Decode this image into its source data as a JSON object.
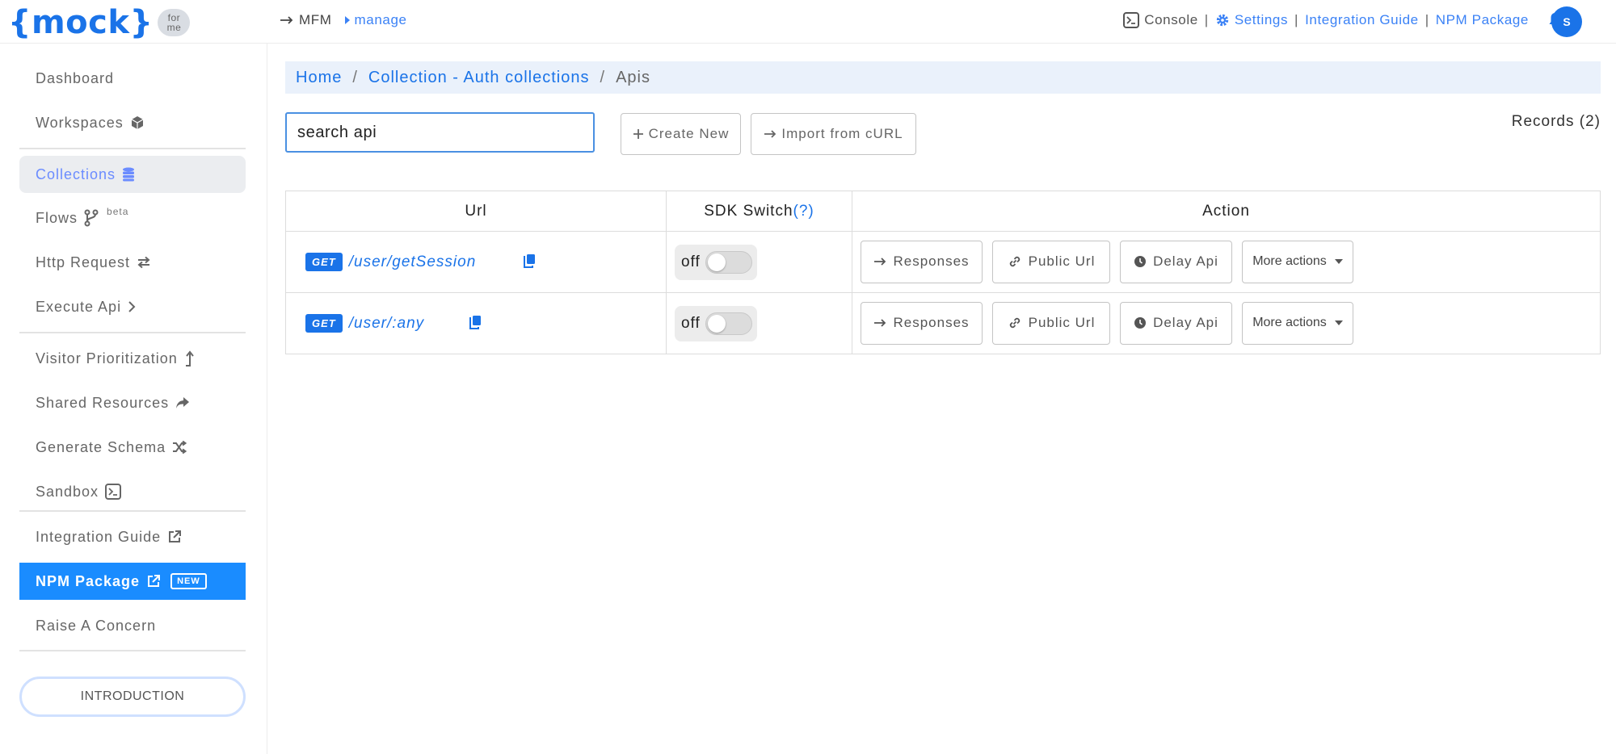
{
  "header": {
    "logo_text": "{mock}",
    "logo_badge_line1": "for",
    "logo_badge_line2": "me",
    "nav_mfm": "MFM",
    "nav_manage": "manage",
    "console": "Console",
    "separator": "|",
    "settings": "Settings",
    "integration_guide": "Integration Guide",
    "npm_package": "NPM Package",
    "avatar_initial": "S",
    "icons": {
      "mfm": "arrow-right-icon",
      "manage": "caret-right-icon",
      "console": "terminal-icon",
      "settings": "gear-icon",
      "notifications": "bell-icon"
    }
  },
  "sidebar": {
    "items": [
      {
        "label": "Dashboard",
        "icon": ""
      },
      {
        "label": "Workspaces",
        "icon": "cube-icon"
      },
      {
        "label": "Collections",
        "icon": "database-icon",
        "active": true
      },
      {
        "label": "Flows",
        "icon": "branch-icon",
        "badge": "beta"
      },
      {
        "label": "Http Request",
        "icon": "exchange-icon"
      },
      {
        "label": "Execute Api",
        "icon": "chevron-right-icon"
      },
      {
        "label": "Visitor Prioritization",
        "icon": "level-up-icon"
      },
      {
        "label": "Shared Resources",
        "icon": "share-icon"
      },
      {
        "label": "Generate Schema",
        "icon": "shuffle-icon"
      },
      {
        "label": "Sandbox",
        "icon": "terminal-icon"
      },
      {
        "label": "Integration Guide",
        "icon": "external-link-icon"
      },
      {
        "label": "NPM Package",
        "icon": "external-link-icon",
        "badge": "NEW",
        "highlight": true
      },
      {
        "label": "Raise A Concern",
        "icon": ""
      }
    ],
    "intro_button": "INTRODUCTION"
  },
  "breadcrumb": {
    "home": "Home",
    "collection": "Collection - Auth collections",
    "current": "Apis",
    "separator": "/"
  },
  "toolbar": {
    "search_value": "search api",
    "create_new": "Create New",
    "import_curl": "Import from cURL",
    "records": "Records (2)"
  },
  "table": {
    "headers": {
      "url": "Url",
      "sdk_switch": "SDK Switch",
      "sdk_help": "(?)",
      "action": "Action"
    },
    "rows": [
      {
        "method": "GET",
        "path": "/user/getSession",
        "sdk_label": "off",
        "sdk_enabled": false
      },
      {
        "method": "GET",
        "path": "/user/:any",
        "sdk_label": "off",
        "sdk_enabled": false
      }
    ],
    "actions": {
      "responses": "Responses",
      "public_url": "Public Url",
      "delay_api": "Delay Api",
      "more_actions": "More actions"
    }
  },
  "colors": {
    "brand": "#1a73e8",
    "link": "#3b82f6",
    "npm_highlight": "#1a8cff",
    "breadcrumb_bg": "#eaf1fb"
  }
}
